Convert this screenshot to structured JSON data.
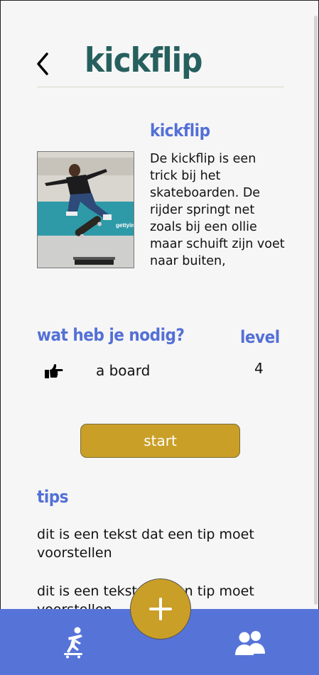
{
  "header": {
    "title": "kickflip",
    "back_icon": "chevron-left-icon"
  },
  "trick": {
    "heading": "kickflip",
    "photo_caption": "gettyimages",
    "description": "De kickflip is een trick bij het skateboarden. De rijder springt net zoals bij een ollie maar schuift zijn voet naar buiten,"
  },
  "needs": {
    "heading": "wat heb je nodig?",
    "icon": "pointing-hand-icon",
    "item": "a board"
  },
  "level": {
    "heading": "level",
    "value": "4"
  },
  "start_button": {
    "label": "start"
  },
  "tips": {
    "heading": "tips",
    "items": [
      "dit is een tekst dat een tip moet voorstellen",
      "dit is een tekst dat een tip moet voorstellen"
    ]
  },
  "nav": {
    "left_icon": "skateboarder-icon",
    "center_icon": "plus-icon",
    "right_icon": "users-icon"
  },
  "colors": {
    "title": "#26605e",
    "heading": "#5470d6",
    "accent": "#c99f27",
    "navbar": "#5674d8",
    "background": "#f6f6f6"
  }
}
